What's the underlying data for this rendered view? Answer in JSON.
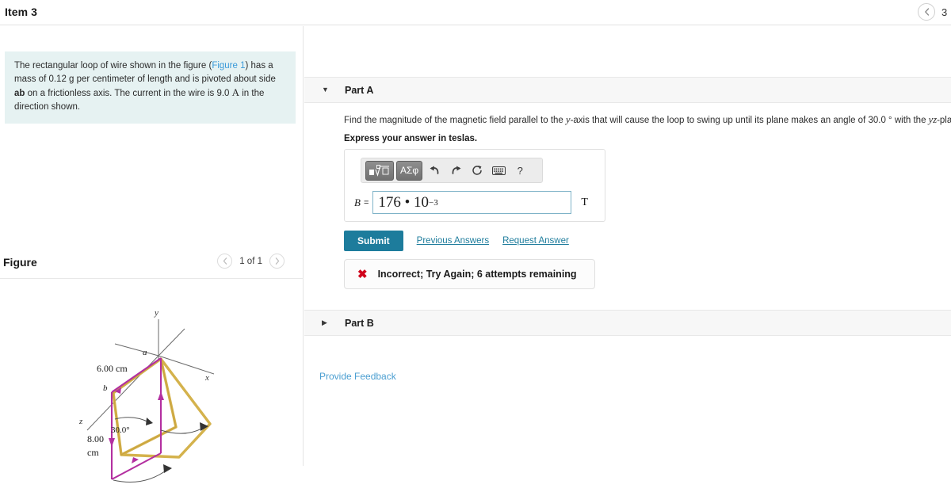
{
  "topbar": {
    "item_title": "Item 3",
    "prev_icon": "chevron-left-icon",
    "page_number": "3"
  },
  "left_panel": {
    "statement": {
      "text_1": "The rectangular loop of wire shown in the figure (",
      "figure_link": "Figure 1",
      "text_2": ") has a mass of 0.12 g per centimeter of length and is pivoted about side ",
      "bold_ab": "ab",
      "text_3": " on a frictionless axis. The current in the wire is 9.0 ",
      "amp_unit": "A",
      "text_4": " in the direction shown."
    },
    "figure": {
      "title": "Figure",
      "prev_icon": "chevron-left-icon",
      "next_icon": "chevron-right-icon",
      "count_label": "1 of 1",
      "labels": {
        "y_axis": "y",
        "x_axis": "x",
        "z_axis": "z",
        "point_a": "a",
        "point_b": "b",
        "side_length": "6.00 cm",
        "height_length_1": "8.00",
        "height_length_2": "cm",
        "angle": "30.0°"
      },
      "colors": {
        "loop_magenta": "#b32fa0",
        "loop_gold": "#d4b24c",
        "axis_gray": "#6b6b6b"
      }
    }
  },
  "right_panel": {
    "part_a": {
      "caret_icon": "caret-down-icon",
      "label": "Part A",
      "question_pre": "Find the magnitude of the magnetic field parallel to the ",
      "question_var_y": "y",
      "question_mid": "-axis that will cause the loop to swing up until its plane makes an angle of 30.0 ° with the ",
      "question_var_yz": "yz",
      "question_post": "-plane.",
      "express": "Express your answer in teslas.",
      "toolbar": {
        "template_button": "template-math-icon",
        "greek_button": "ΑΣφ",
        "undo_icon": "undo-icon",
        "redo_icon": "redo-icon",
        "reset_icon": "reset-icon",
        "keyboard_icon": "keyboard-icon",
        "help_icon": "?"
      },
      "answer": {
        "variable": "B",
        "equals": "=",
        "value_mantissa": "176 • 10",
        "value_exponent": "−3",
        "unit": "T"
      },
      "submit_label": "Submit",
      "previous_answers_label": "Previous Answers",
      "request_answer_label": "Request Answer",
      "feedback": {
        "icon": "x-mark-icon",
        "text": "Incorrect; Try Again; 6 attempts remaining"
      }
    },
    "part_b": {
      "caret_icon": "caret-right-icon",
      "label": "Part B"
    },
    "provide_feedback_label": "Provide Feedback"
  },
  "colors": {
    "accent": "#1d7c9c",
    "statement_bg": "#e6f2f2",
    "error": "#d0021b",
    "link": "#4a9ed1"
  }
}
